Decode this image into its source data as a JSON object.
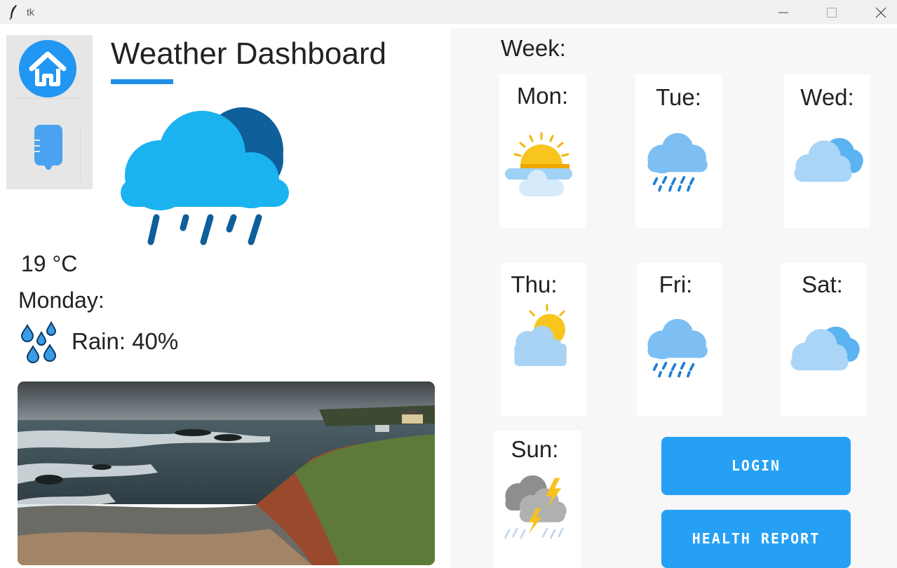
{
  "window": {
    "title": "tk"
  },
  "sidebar": {
    "home_icon": "home-icon",
    "report_icon": "health-report-icon"
  },
  "header": {
    "title": "Weather Dashboard"
  },
  "current": {
    "icon": "rain-cloud-icon",
    "temperature": "19 °C",
    "day": "Monday:",
    "rain": "Rain: 40%",
    "rain_icon": "water-drops-icon",
    "photo_icon": "rainy-coast-photo"
  },
  "week": {
    "label": "Week:",
    "days": [
      {
        "label": "Mon:",
        "icon": "sun-behind-cloud-icon"
      },
      {
        "label": "Tue:",
        "icon": "rain-cloud-icon"
      },
      {
        "label": "Wed:",
        "icon": "cloudy-icon"
      },
      {
        "label": "Thu:",
        "icon": "partly-sunny-icon"
      },
      {
        "label": "Fri:",
        "icon": "rain-cloud-icon"
      },
      {
        "label": "Sat:",
        "icon": "cloudy-icon"
      },
      {
        "label": "Sun:",
        "icon": "thunderstorm-icon"
      }
    ]
  },
  "actions": {
    "login": "LOGIN",
    "health_report": "HEALTH REPORT"
  },
  "colors": {
    "accent": "#1e90e8",
    "button": "#25a0f5"
  }
}
